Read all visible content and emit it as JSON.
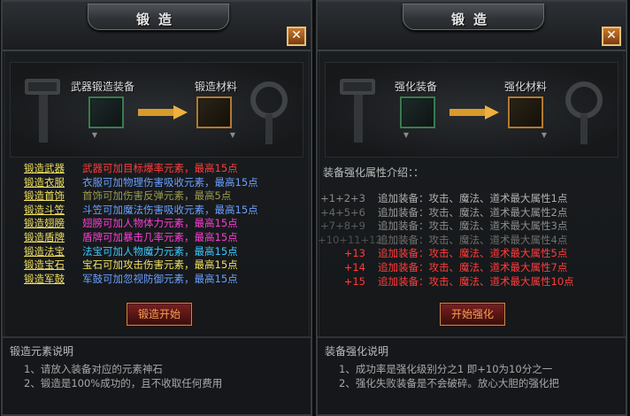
{
  "left": {
    "title": "锻造",
    "close_label": "✕",
    "slot_input_label": "武器锻造装备",
    "slot_output_label": "锻造材料",
    "items": [
      {
        "label": "锻造武器",
        "text": "武器可加目标爆率元素，最高15点",
        "color": "#ff3c3c"
      },
      {
        "label": "锻造衣服",
        "text": "衣服可加物理伤害吸收元素，最高15点",
        "color": "#6aa0ff"
      },
      {
        "label": "锻造首饰",
        "text": "首饰可加伤害反弹元素，最高5点",
        "color": "#9a9a50"
      },
      {
        "label": "锻造斗笠",
        "text": "斗笠可加魔法伤害吸收元素，最高15点",
        "color": "#6aa0ff"
      },
      {
        "label": "锻造翅膀",
        "text": "翅膀可加人物体力元素，最高15点",
        "color": "#ff3cd8"
      },
      {
        "label": "锻造盾牌",
        "text": "盾牌可加暴击几率元素，最高15点",
        "color": "#ff3cd8"
      },
      {
        "label": "锻造法宝",
        "text": "法宝可加人物魔力元素，最高15点",
        "color": "#3cc8ff"
      },
      {
        "label": "锻造宝石",
        "text": "宝石可加攻击伤害元素，最高15点",
        "color": "#f0e060"
      },
      {
        "label": "锻造军鼓",
        "text": "军鼓可加忽视防御元素，最高15点",
        "color": "#6aa0ff"
      }
    ],
    "action_label": "锻造开始",
    "notes_title": "锻造元素说明",
    "notes": [
      "1、请放入装备对应的元素神石",
      "2、锻造是100%成功的，且不收取任何费用"
    ]
  },
  "right": {
    "title": "锻造",
    "close_label": "✕",
    "slot_input_label": "强化装备",
    "slot_output_label": "强化材料",
    "attr_heading": "装备强化属性介绍：：",
    "attrs": [
      {
        "level": "+1+2+3",
        "text": "追加装备：攻击、魔法、道术最大属性1点",
        "color": "#b0b0b0",
        "lvl_color": "#8a8a8a"
      },
      {
        "level": "+4+5+6",
        "text": "追加装备：攻击、魔法、道术最大属性2点",
        "color": "#9a9a9a",
        "lvl_color": "#6a6a6a"
      },
      {
        "level": "+7+8+9",
        "text": "追加装备：攻击、魔法、道术最大属性3点",
        "color": "#8a8a8a",
        "lvl_color": "#5a5a5a"
      },
      {
        "level": "+10+11+12",
        "text": "追加装备：攻击、魔法、道术最大属性4点",
        "color": "#6e6e6e",
        "lvl_color": "#4e4e4e"
      },
      {
        "level": "+13",
        "text": "追加装备：攻击、魔法、道术最大属性5点",
        "color": "#ff3c3c",
        "lvl_color": "#ff3c3c"
      },
      {
        "level": "+14",
        "text": "追加装备：攻击、魔法、道术最大属性7点",
        "color": "#ff3c3c",
        "lvl_color": "#ff3c3c"
      },
      {
        "level": "+15",
        "text": "追加装备：攻击、魔法、道术最大属性10点",
        "color": "#ff3c3c",
        "lvl_color": "#ff3c3c"
      }
    ],
    "action_label": "开始强化",
    "notes_title": "装备强化说明",
    "notes": [
      "1、成功率是强化级别分之1 即+10为10分之一",
      "2、强化失败装备是不会破碎。放心大胆的强化把"
    ]
  }
}
